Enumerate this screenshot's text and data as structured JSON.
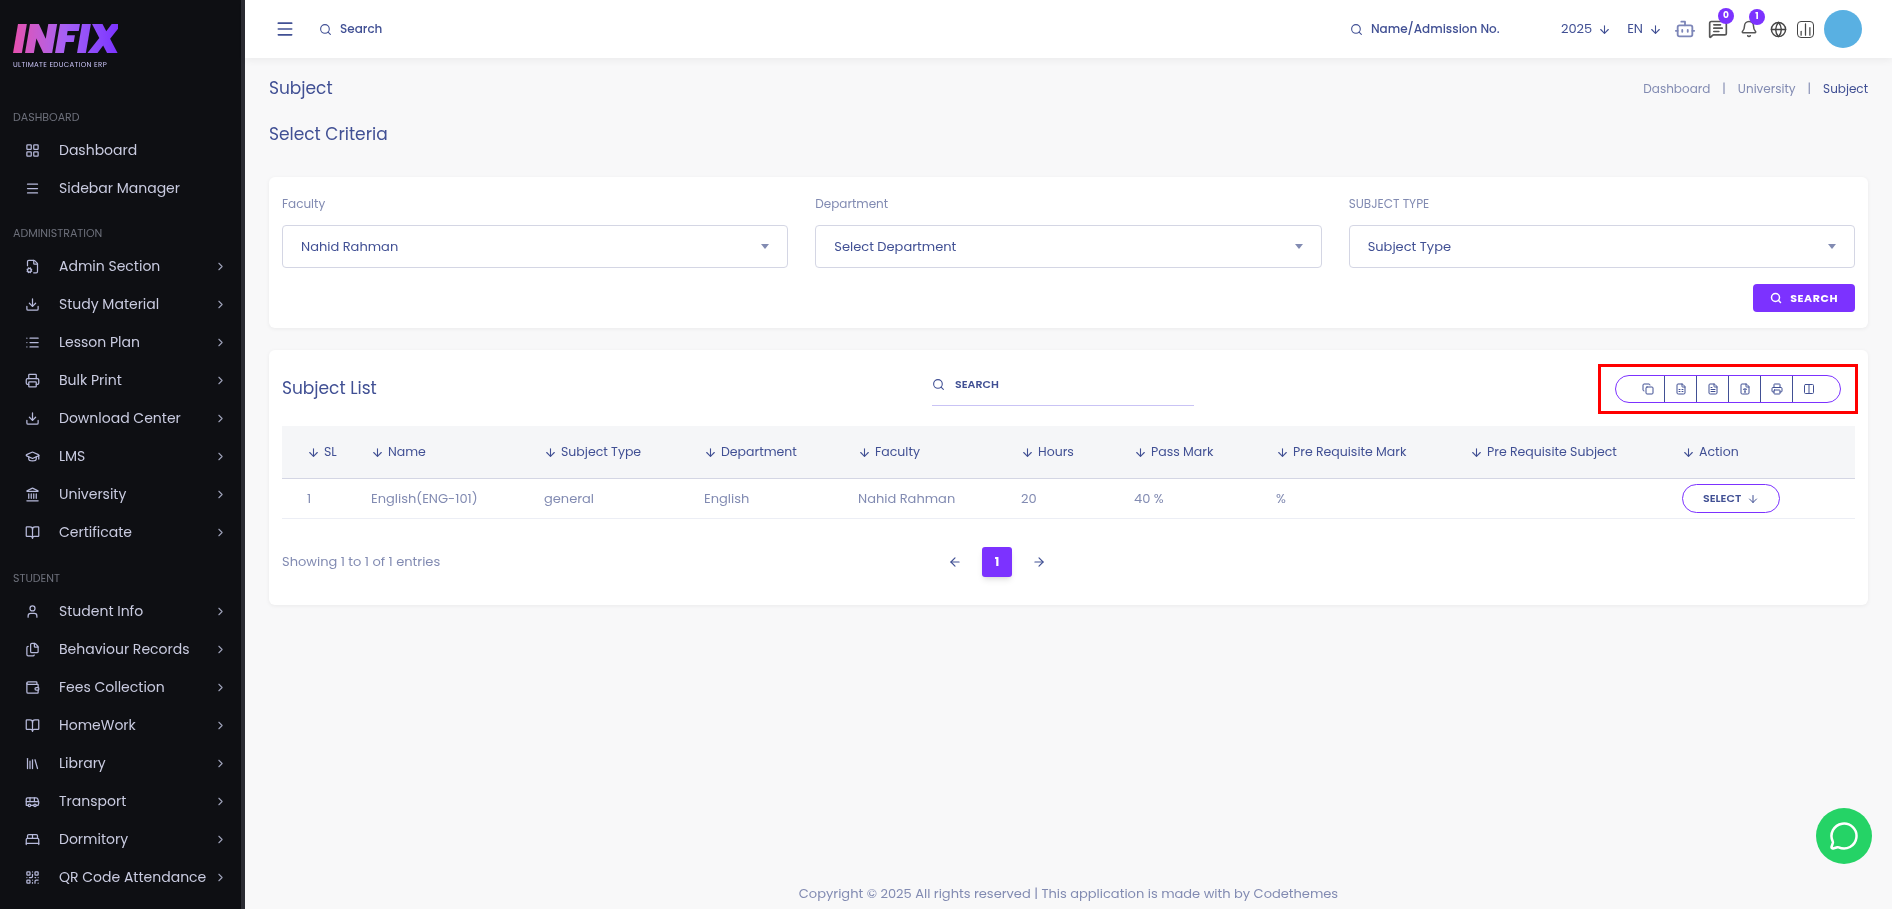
{
  "sidebar": {
    "logo": {
      "name": "INFIX",
      "tagline": "ULTIMATE EDUCATION ERP"
    },
    "sections": [
      {
        "title": "DASHBOARD",
        "items": [
          {
            "label": "Dashboard",
            "expandable": false
          },
          {
            "label": "Sidebar Manager",
            "expandable": false
          }
        ]
      },
      {
        "title": "ADMINISTRATION",
        "items": [
          {
            "label": "Admin Section",
            "expandable": true
          },
          {
            "label": "Study Material",
            "expandable": true
          },
          {
            "label": "Lesson Plan",
            "expandable": true
          },
          {
            "label": "Bulk Print",
            "expandable": true
          },
          {
            "label": "Download Center",
            "expandable": true
          },
          {
            "label": "LMS",
            "expandable": true
          },
          {
            "label": "University",
            "expandable": true
          },
          {
            "label": "Certificate",
            "expandable": true
          }
        ]
      },
      {
        "title": "STUDENT",
        "items": [
          {
            "label": "Student Info",
            "expandable": true
          },
          {
            "label": "Behaviour Records",
            "expandable": true
          },
          {
            "label": "Fees Collection",
            "expandable": true
          },
          {
            "label": "HomeWork",
            "expandable": true
          },
          {
            "label": "Library",
            "expandable": true
          },
          {
            "label": "Transport",
            "expandable": true
          },
          {
            "label": "Dormitory",
            "expandable": true
          },
          {
            "label": "QR Code Attendance",
            "expandable": true
          }
        ]
      }
    ]
  },
  "header": {
    "search_placeholder": "Search",
    "student_search_placeholder": "Name/Admission No.",
    "year": "2025",
    "language": "EN",
    "messages_count": "0",
    "notifications_count": "1"
  },
  "page": {
    "title": "Subject",
    "breadcrumbs": [
      "Dashboard",
      "University",
      "Subject"
    ],
    "breadcrumb_separators": [
      "|",
      "|"
    ],
    "criteria_title": "Select Criteria"
  },
  "criteria": {
    "fields": [
      {
        "label": "Faculty",
        "value": "Nahid Rahman"
      },
      {
        "label": "Department",
        "placeholder": "Select Department"
      },
      {
        "label": "SUBJECT TYPE",
        "placeholder": "Subject Type"
      }
    ],
    "search_button": "SEARCH"
  },
  "subject_list": {
    "title": "Subject List",
    "search_placeholder": "SEARCH",
    "columns": [
      "SL",
      "Name",
      "Subject Type",
      "Department",
      "Faculty",
      "Hours",
      "Pass Mark",
      "Pre Requisite Mark",
      "Pre Requisite Subject",
      "Action"
    ],
    "rows": [
      {
        "cells": [
          "1",
          "English(ENG-101)",
          "general",
          "English",
          "Nahid Rahman",
          "20",
          "40 %",
          "%",
          ""
        ],
        "action": "SELECT"
      }
    ],
    "footer": "Showing 1 to 1 of 1 entries",
    "pages": [
      {
        "label": "1",
        "selected": true
      }
    ]
  },
  "footer": {
    "copyright": "Copyright © 2025 All rights reserved | This application is made with by Codethemes"
  }
}
